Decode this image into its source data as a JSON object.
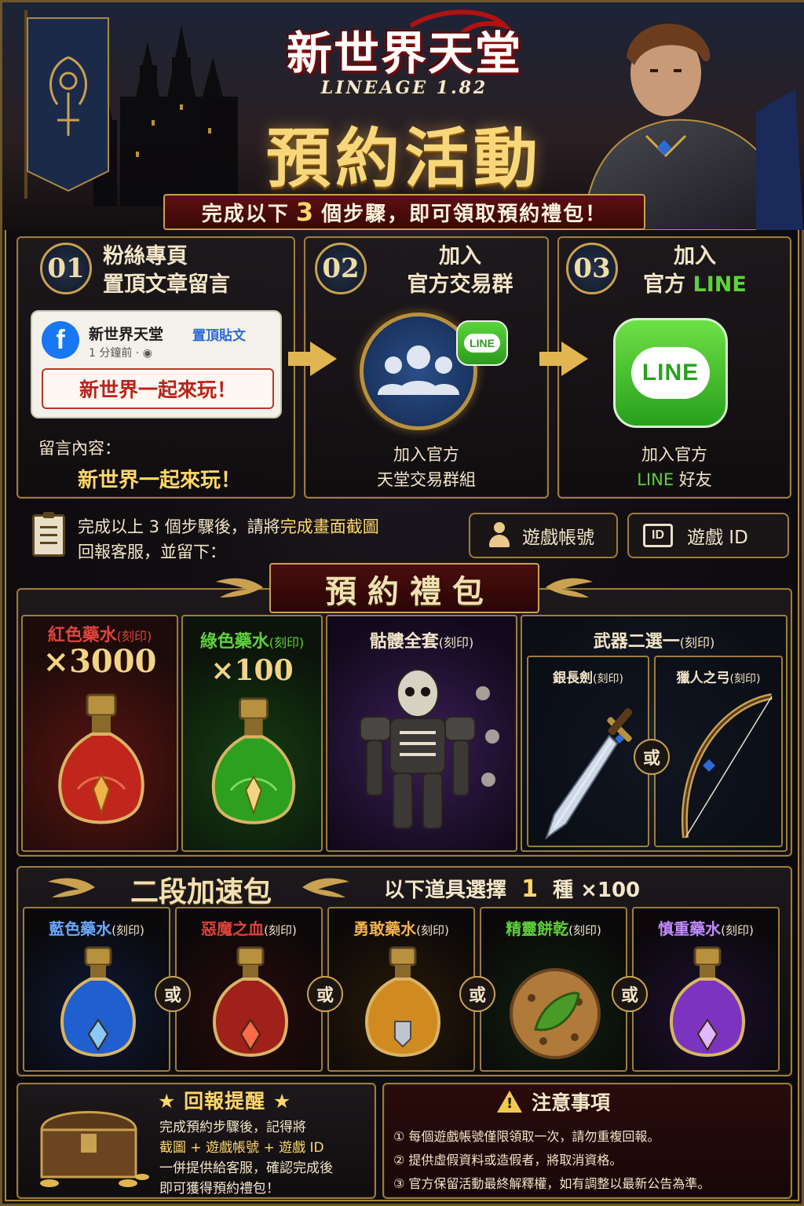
{
  "header": {
    "logo_title": "新世界天堂",
    "logo_sub": "LINEAGE 1.82",
    "main_title": "預約活動",
    "subtitle_pre": "完成以下",
    "subtitle_num": "3",
    "subtitle_post": "個步驟，即可領取預約禮包！"
  },
  "steps": [
    {
      "num": "01",
      "title_line1": "粉絲專頁",
      "title_line2": "置頂文章留言",
      "fb_name": "新世界天堂",
      "fb_pin": "置頂貼文",
      "fb_time": "1 分鐘前 · ◉",
      "fb_comment": "新世界一起來玩！",
      "comment_label": "留言內容：",
      "comment_value": "新世界一起來玩！"
    },
    {
      "num": "02",
      "title_line1": "加入",
      "title_line2": "官方交易群",
      "badge": "LINE",
      "desc_line1": "加入官方",
      "desc_line2": "天堂交易群組"
    },
    {
      "num": "03",
      "title_line1": "加入",
      "title_line2_pre": "官方",
      "title_line2_line": "LINE",
      "logo": "LINE",
      "desc_line1": "加入官方",
      "desc_line2_line": "LINE",
      "desc_line2_post": "好友"
    }
  ],
  "report": {
    "line1_pre": "完成以上 3 個步驟後，請將",
    "line1_hl": "完成畫面截圖",
    "line2": "回報客服，並留下：",
    "account_label": "遊戲帳號",
    "id_icon": "ID",
    "id_label": "遊戲 ID"
  },
  "gift_section": {
    "title": "預 約 禮 包",
    "items": [
      {
        "name": "紅色藥水",
        "tag": "(刻印)",
        "qty": "×3000",
        "icon": "red-potion-icon",
        "color": "#e0433a"
      },
      {
        "name": "綠色藥水",
        "tag": "(刻印)",
        "qty": "×100",
        "icon": "green-potion-icon",
        "color": "#5fd13a"
      },
      {
        "name": "骷髏全套",
        "tag": "(刻印)",
        "icon": "skeleton-armor-icon"
      }
    ],
    "weapon": {
      "title": "武器二選一",
      "tag": "(刻印)",
      "options": [
        {
          "name": "銀長劍",
          "tag": "(刻印)",
          "icon": "sword-icon"
        },
        {
          "name": "獵人之弓",
          "tag": "(刻印)",
          "icon": "bow-icon"
        }
      ],
      "or": "或"
    }
  },
  "speed_section": {
    "title": "二段加速包",
    "hint_pre": "以下道具選擇",
    "hint_num": "1",
    "hint_post": "種  ×100",
    "or": "或",
    "items": [
      {
        "name": "藍色藥水",
        "tag": "(刻印)",
        "icon": "blue-potion-icon",
        "color": "#6aa8ff"
      },
      {
        "name": "惡魔之血",
        "tag": "(刻印)",
        "icon": "demon-blood-icon",
        "color": "#e0433a"
      },
      {
        "name": "勇敢藥水",
        "tag": "(刻印)",
        "icon": "brave-potion-icon",
        "color": "#f2b24a"
      },
      {
        "name": "精靈餅乾",
        "tag": "(刻印)",
        "icon": "elf-cookie-icon",
        "color": "#5fd13a"
      },
      {
        "name": "慎重藥水",
        "tag": "(刻印)",
        "icon": "caution-potion-icon",
        "color": "#c08cff"
      }
    ]
  },
  "reminder": {
    "title": "★ 回報提醒 ★",
    "line1": "完成預約步驟後，記得將",
    "line2_hl": "截圖 + 遊戲帳號 + 遊戲 ID",
    "line3": "一併提供給客服，確認完成後",
    "line4": "即可獲得預約禮包！"
  },
  "notice": {
    "title": "注意事項",
    "items": [
      "① 每個遊戲帳號僅限領取一次，請勿重複回報。",
      "② 提供虛假資料或造假者，將取消資格。",
      "③ 官方保留活動最終解釋權，如有調整以最新公告為準。"
    ]
  }
}
